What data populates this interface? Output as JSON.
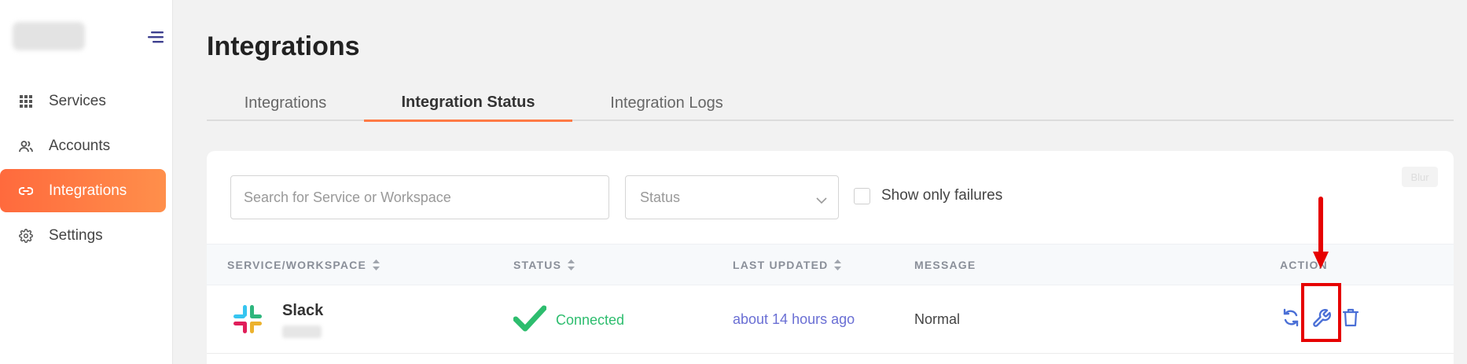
{
  "sidebar": {
    "items": [
      {
        "label": "Services",
        "icon": "grid-icon",
        "active": false
      },
      {
        "label": "Accounts",
        "icon": "users-icon",
        "active": false
      },
      {
        "label": "Integrations",
        "icon": "link-icon",
        "active": true
      },
      {
        "label": "Settings",
        "icon": "gear-icon",
        "active": false
      }
    ]
  },
  "page": {
    "title": "Integrations"
  },
  "tabs": [
    {
      "label": "Integrations",
      "active": false
    },
    {
      "label": "Integration Status",
      "active": true
    },
    {
      "label": "Integration Logs",
      "active": false
    }
  ],
  "filters": {
    "search_placeholder": "Search for Service or Workspace",
    "status_placeholder": "Status",
    "failures_label": "Show only failures",
    "failures_checked": false,
    "badge": "Blur"
  },
  "table": {
    "columns": [
      "SERVICE/WORKSPACE",
      "STATUS",
      "LAST UPDATED",
      "MESSAGE",
      "ACTION"
    ],
    "rows": [
      {
        "service": "Slack",
        "status": "Connected",
        "updated": "about 14 hours ago",
        "message": "Normal"
      }
    ]
  },
  "colors": {
    "accent": "#ff7a45",
    "connected": "#2dbd6e",
    "link": "#6a6fd4",
    "annotation": "#e60000"
  }
}
